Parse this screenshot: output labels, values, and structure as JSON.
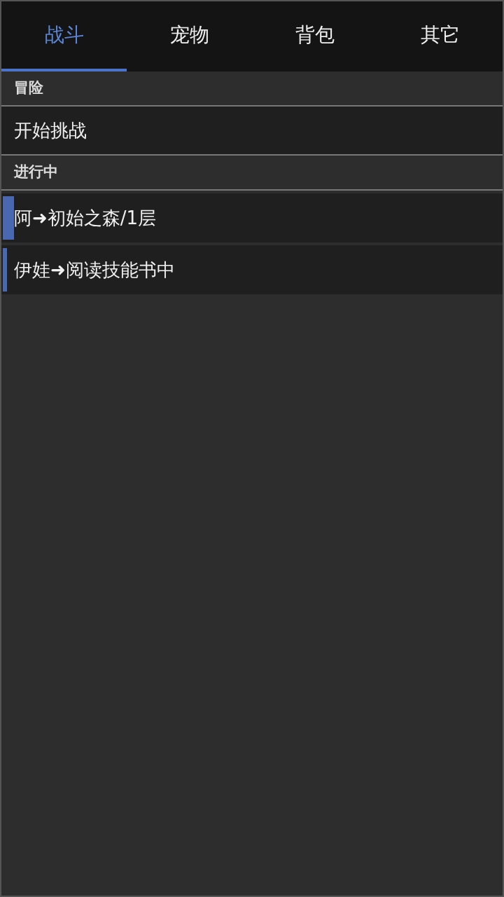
{
  "tabs": [
    {
      "label": "战斗",
      "selected": true
    },
    {
      "label": "宠物",
      "selected": false
    },
    {
      "label": "背包",
      "selected": false
    },
    {
      "label": "其它",
      "selected": false
    }
  ],
  "sections": [
    {
      "title": "冒险",
      "items": [
        {
          "kind": "action",
          "label": "开始挑战"
        }
      ]
    },
    {
      "title": "进行中",
      "items": [
        {
          "kind": "progress",
          "label": "阿➜初始之森/1层",
          "level": 0.023
        },
        {
          "kind": "progress",
          "label": "伊娃➜阅读技能书中",
          "level": 0.009
        }
      ]
    }
  ]
}
